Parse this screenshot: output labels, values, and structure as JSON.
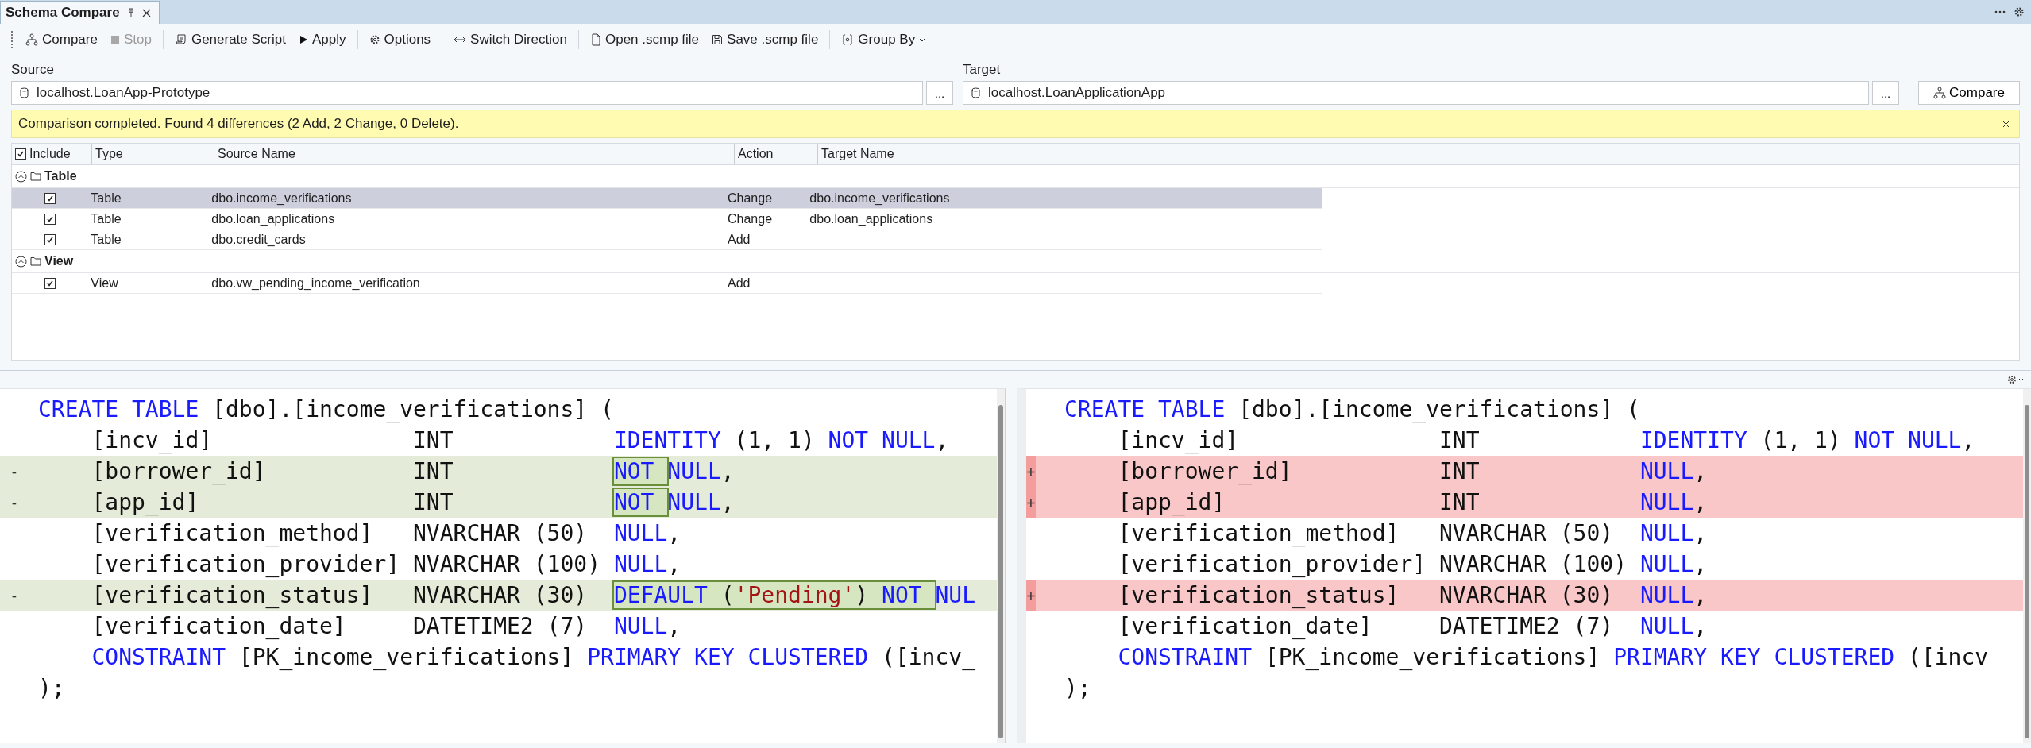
{
  "tab": {
    "title": "Schema Compare"
  },
  "toolbar": [
    [
      {
        "kind": "compare",
        "label": "Compare",
        "disabled": false
      },
      {
        "kind": "stop",
        "label": "Stop",
        "disabled": true
      }
    ],
    [
      {
        "kind": "script",
        "label": "Generate Script",
        "disabled": false
      },
      {
        "kind": "apply",
        "label": "Apply",
        "disabled": false
      }
    ],
    [
      {
        "kind": "options",
        "label": "Options",
        "disabled": false
      }
    ],
    [
      {
        "kind": "switch",
        "label": "Switch Direction",
        "disabled": false
      }
    ],
    [
      {
        "kind": "open",
        "label": "Open .scmp file",
        "disabled": false
      },
      {
        "kind": "save",
        "label": "Save .scmp file",
        "disabled": false
      }
    ],
    [
      {
        "kind": "group",
        "label": "Group By",
        "disabled": false
      }
    ]
  ],
  "source": {
    "label": "Source",
    "value": "localhost.LoanApp-Prototype",
    "browse": "..."
  },
  "target": {
    "label": "Target",
    "value": "localhost.LoanApplicationApp",
    "browse": "...",
    "button": "Compare"
  },
  "banner": {
    "message": "Comparison completed. Found 4 differences (2 Add, 2 Change, 0 Delete)."
  },
  "grid": {
    "include_all": true,
    "columns": [
      "Include",
      "Type",
      "Source Name",
      "Action",
      "Target Name"
    ],
    "groups": [
      {
        "name": "Table",
        "expanded": true,
        "items": [
          {
            "checked": true,
            "type": "Table",
            "source_name": "dbo.income_verifications",
            "action": "Change",
            "target_name": "dbo.income_verifications",
            "selected": true
          },
          {
            "checked": true,
            "type": "Table",
            "source_name": "dbo.loan_applications",
            "action": "Change",
            "target_name": "dbo.loan_applications",
            "selected": false
          },
          {
            "checked": true,
            "type": "Table",
            "source_name": "dbo.credit_cards",
            "action": "Add",
            "selected": false
          }
        ]
      },
      {
        "name": "View",
        "expanded": true,
        "items": [
          {
            "checked": true,
            "type": "View",
            "source_name": "dbo.vw_pending_income_verification",
            "action": "Add",
            "selected": false
          }
        ]
      }
    ]
  },
  "scripts": [
    {
      "kind": "source",
      "lines": [
        {
          "tokens": [
            {
              "text": "CREATE TABLE",
              "kind": "keyword"
            },
            {
              "text": " [dbo].[income_verifications] (",
              "kind": "plain"
            }
          ]
        },
        {
          "tokens": [
            {
              "text": "    [incv_id]               INT            ",
              "kind": "plain"
            },
            {
              "text": "IDENTITY",
              "kind": "keyword"
            },
            {
              "text": " (1, 1) ",
              "kind": "plain"
            },
            {
              "text": "NOT NULL",
              "kind": "keyword"
            },
            {
              "text": ",",
              "kind": "plain"
            }
          ]
        },
        {
          "marker": "-",
          "tokens": [
            {
              "text": "    [borrower_id]           INT            ",
              "kind": "plain"
            },
            {
              "kind": "difference",
              "tokens": [
                {
                  "text": "NOT ",
                  "kind": "keyword"
                }
              ]
            },
            {
              "text": "NULL",
              "kind": "keyword"
            },
            {
              "text": ",",
              "kind": "plain"
            }
          ]
        },
        {
          "marker": "-",
          "tokens": [
            {
              "text": "    [app_id]                INT            ",
              "kind": "plain"
            },
            {
              "kind": "difference",
              "tokens": [
                {
                  "text": "NOT ",
                  "kind": "keyword"
                }
              ]
            },
            {
              "text": "NULL",
              "kind": "keyword"
            },
            {
              "text": ",",
              "kind": "plain"
            }
          ]
        },
        {
          "tokens": [
            {
              "text": "    [verification_method]   NVARCHAR (50)  ",
              "kind": "plain"
            },
            {
              "text": "NULL",
              "kind": "keyword"
            },
            {
              "text": ",",
              "kind": "plain"
            }
          ]
        },
        {
          "tokens": [
            {
              "text": "    [verification_provider] NVARCHAR (100) ",
              "kind": "plain"
            },
            {
              "text": "NULL",
              "kind": "keyword"
            },
            {
              "text": ",",
              "kind": "plain"
            }
          ]
        },
        {
          "marker": "-",
          "tokens": [
            {
              "text": "    [verification_status]   NVARCHAR (30)  ",
              "kind": "plain"
            },
            {
              "kind": "difference",
              "tokens": [
                {
                  "text": "DEFAULT",
                  "kind": "keyword"
                },
                {
                  "text": " (",
                  "kind": "plain"
                },
                {
                  "text": "'Pending'",
                  "kind": "string"
                },
                {
                  "text": ") ",
                  "kind": "plain"
                },
                {
                  "text": "NOT ",
                  "kind": "keyword"
                }
              ]
            },
            {
              "text": "NUL",
              "kind": "keyword"
            }
          ]
        },
        {
          "tokens": [
            {
              "text": "    [verification_date]     DATETIME2 (7)  ",
              "kind": "plain"
            },
            {
              "text": "NULL",
              "kind": "keyword"
            },
            {
              "text": ",",
              "kind": "plain"
            }
          ]
        },
        {
          "tokens": [
            {
              "text": "    CONSTRAINT",
              "kind": "keyword"
            },
            {
              "text": " [PK_income_verifications] ",
              "kind": "plain"
            },
            {
              "text": "PRIMARY KEY CLUSTERED",
              "kind": "keyword"
            },
            {
              "text": " ([incv_",
              "kind": "plain"
            }
          ]
        },
        {
          "tokens": [
            {
              "text": ");",
              "kind": "plain"
            }
          ]
        }
      ]
    },
    {
      "kind": "target",
      "lines": [
        {
          "tokens": [
            {
              "text": "CREATE TABLE",
              "kind": "keyword"
            },
            {
              "text": " [dbo].[income_verifications] (",
              "kind": "plain"
            }
          ]
        },
        {
          "tokens": [
            {
              "text": "    [incv_id]               INT            ",
              "kind": "plain"
            },
            {
              "text": "IDENTITY",
              "kind": "keyword"
            },
            {
              "text": " (1, 1) ",
              "kind": "plain"
            },
            {
              "text": "NOT NULL",
              "kind": "keyword"
            },
            {
              "text": ",",
              "kind": "plain"
            }
          ]
        },
        {
          "marker": "+",
          "tokens": [
            {
              "text": "    [borrower_id]           INT            ",
              "kind": "plain"
            },
            {
              "text": "NULL",
              "kind": "keyword"
            },
            {
              "text": ",",
              "kind": "plain"
            }
          ]
        },
        {
          "marker": "+",
          "tokens": [
            {
              "text": "    [app_id]                INT            ",
              "kind": "plain"
            },
            {
              "text": "NULL",
              "kind": "keyword"
            },
            {
              "text": ",",
              "kind": "plain"
            }
          ]
        },
        {
          "tokens": [
            {
              "text": "    [verification_method]   NVARCHAR (50)  ",
              "kind": "plain"
            },
            {
              "text": "NULL",
              "kind": "keyword"
            },
            {
              "text": ",",
              "kind": "plain"
            }
          ]
        },
        {
          "tokens": [
            {
              "text": "    [verification_provider] NVARCHAR (100) ",
              "kind": "plain"
            },
            {
              "text": "NULL",
              "kind": "keyword"
            },
            {
              "text": ",",
              "kind": "plain"
            }
          ]
        },
        {
          "marker": "+",
          "tokens": [
            {
              "text": "    [verification_status]   NVARCHAR (30)  ",
              "kind": "plain"
            },
            {
              "text": "NULL",
              "kind": "keyword"
            },
            {
              "text": ",",
              "kind": "plain"
            }
          ]
        },
        {
          "tokens": [
            {
              "text": "    [verification_date]     DATETIME2 (7)  ",
              "kind": "plain"
            },
            {
              "text": "NULL",
              "kind": "keyword"
            },
            {
              "text": ",",
              "kind": "plain"
            }
          ]
        },
        {
          "tokens": [
            {
              "text": "    CONSTRAINT",
              "kind": "keyword"
            },
            {
              "text": " [PK_income_verifications] ",
              "kind": "plain"
            },
            {
              "text": "PRIMARY KEY CLUSTERED",
              "kind": "keyword"
            },
            {
              "text": " ([incv",
              "kind": "plain"
            }
          ]
        },
        {
          "tokens": [
            {
              "text": ");",
              "kind": "plain"
            }
          ]
        }
      ]
    }
  ]
}
